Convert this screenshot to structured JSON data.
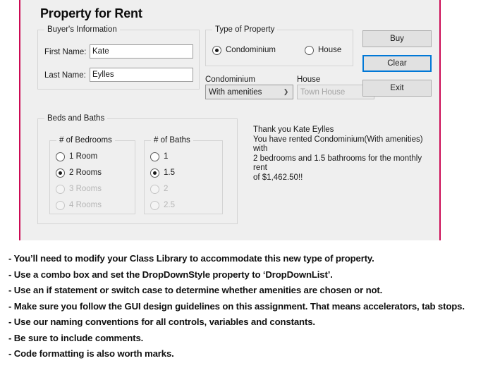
{
  "app": {
    "title": "Property for Rent",
    "accent_color": "#cc0a54",
    "focus_color": "#0078d7",
    "background_color": "#efefef"
  },
  "buyer_group": {
    "title": "Buyer's Information",
    "first_name_label": "First Name:",
    "first_name_value": "Kate",
    "first_name_placeholder": "",
    "last_name_label": "Last Name:",
    "last_name_value": "Eylles",
    "last_name_placeholder": ""
  },
  "type_group": {
    "title": "Type of Property",
    "options": [
      {
        "label": "Condominium",
        "checked": true,
        "enabled": true
      },
      {
        "label": "House",
        "checked": false,
        "enabled": true
      }
    ]
  },
  "condo_combo": {
    "label": "Condominium",
    "value": "With amenities",
    "arrow_icon": "chevron-down-icon",
    "enabled": true
  },
  "house_combo": {
    "label": "House",
    "value": "Town House",
    "arrow_icon": "chevron-down-icon",
    "enabled": false
  },
  "buttons": {
    "buy": "Buy",
    "clear": "Clear",
    "exit": "Exit",
    "focused": "Clear"
  },
  "beds_baths_group": {
    "title": "Beds and Baths",
    "bedrooms": {
      "title": "# of Bedrooms",
      "options": [
        {
          "label": "1 Room",
          "checked": false,
          "enabled": true
        },
        {
          "label": "2 Rooms",
          "checked": true,
          "enabled": true
        },
        {
          "label": "3 Rooms",
          "checked": false,
          "enabled": false
        },
        {
          "label": "4 Rooms",
          "checked": false,
          "enabled": false
        }
      ]
    },
    "baths": {
      "title": "# of Baths",
      "options": [
        {
          "label": "1",
          "checked": false,
          "enabled": true
        },
        {
          "label": "1.5",
          "checked": true,
          "enabled": true
        },
        {
          "label": "2",
          "checked": false,
          "enabled": false
        },
        {
          "label": "2.5",
          "checked": false,
          "enabled": false
        }
      ]
    }
  },
  "confirmation": {
    "text": " Thank you Kate Eylles\nYou have rented Condominium(With amenities) with\n2 bedrooms and 1.5 bathrooms for the monthly rent\nof $1,462.50!!"
  },
  "notes": {
    "lines": [
      "- You’ll need to modify your Class Library to accommodate this new type of property.",
      "- Use a combo box and set the DropDownStyle property to ‘DropDownList’.",
      "- Use an if statement or switch case to determine whether amenities are chosen or not.",
      "- Make sure you follow the GUI design guidelines on this assignment. That means accelerators, tab stops.",
      "- Use our naming conventions for all controls, variables and constants.",
      "- Be sure to include comments.",
      "- Code formatting is also worth marks."
    ]
  }
}
